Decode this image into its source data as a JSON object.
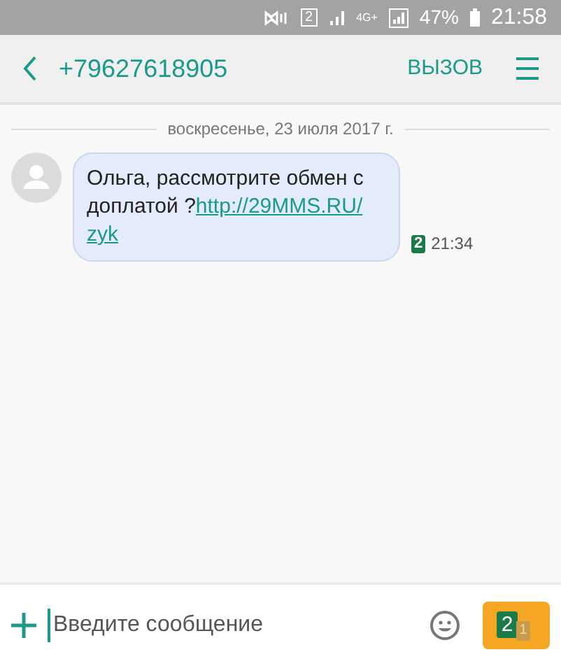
{
  "status_bar": {
    "sim": "2",
    "network": "4G+",
    "battery": "47%",
    "time": "21:58"
  },
  "header": {
    "title": "+79627618905",
    "call": "ВЫЗОВ"
  },
  "date_divider": "воскресенье, 23 июля 2017 г.",
  "messages": [
    {
      "text": "Ольга, рассмотрите обмен с доплатой ?",
      "link_lines": [
        "http://29MMS.RU/",
        "zyk"
      ],
      "sim": "2",
      "time": "21:34"
    }
  ],
  "composer": {
    "placeholder": "Введите сообщение",
    "send_sim": "2",
    "send_sim_alt": "1"
  }
}
